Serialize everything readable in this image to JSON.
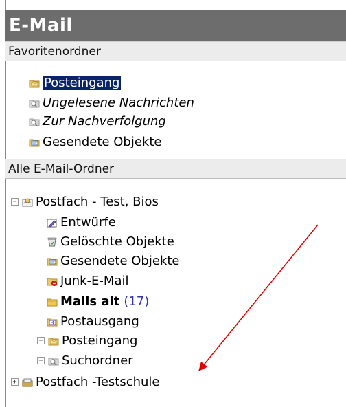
{
  "panel": {
    "title": "E-Mail"
  },
  "favorites": {
    "header": "Favoritenordner",
    "items": [
      {
        "label": "Posteingang",
        "icon": "inbox-folder-icon",
        "selected": true
      },
      {
        "label": "Ungelesene Nachrichten",
        "icon": "search-folder-icon",
        "italic": true
      },
      {
        "label": "Zur Nachverfolgung",
        "icon": "search-folder-icon",
        "italic": true
      },
      {
        "label": "Gesendete Objekte",
        "icon": "sent-items-folder-icon"
      }
    ]
  },
  "all_folders": {
    "header": "Alle E-Mail-Ordner",
    "mailbox1": {
      "label": "Postfach - Test, Bios",
      "expander": "−",
      "children": [
        {
          "label": "Entwürfe",
          "icon": "drafts-folder-icon"
        },
        {
          "label": "Gelöschte Objekte",
          "icon": "deleted-items-folder-icon"
        },
        {
          "label": "Gesendete Objekte",
          "icon": "sent-items-folder-icon"
        },
        {
          "label": "Junk-E-Mail",
          "icon": "junk-folder-icon"
        },
        {
          "label": "Mails alt",
          "icon": "folder-icon",
          "bold": true,
          "count": "(17)"
        },
        {
          "label": "Postausgang",
          "icon": "outbox-folder-icon"
        },
        {
          "label": "Posteingang",
          "icon": "inbox-folder-icon",
          "expander": "+"
        },
        {
          "label": "Suchordner",
          "icon": "search-folder-icon",
          "expander": "+"
        }
      ]
    },
    "mailbox2": {
      "label": "Postfach -Testschule",
      "expander": "+"
    }
  },
  "colors": {
    "title_bg": "#6d6d6d",
    "section_bg": "#ececec",
    "selection_bg": "#0a246a",
    "arrow": "#e00000",
    "count": "#3333aa"
  }
}
